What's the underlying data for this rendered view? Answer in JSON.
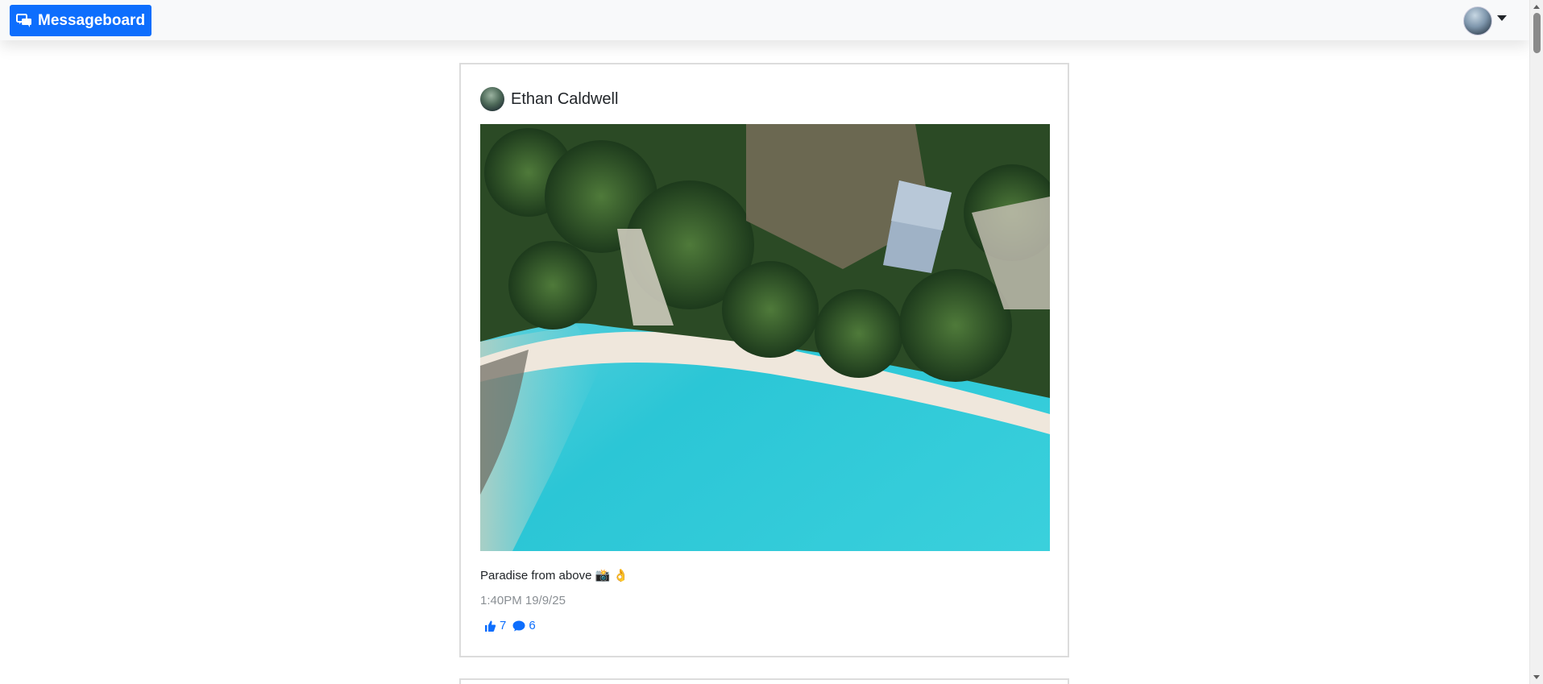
{
  "navbar": {
    "brand_label": "Messageboard",
    "brand_icon": "chat-bubbles-icon",
    "user_avatar": "user-avatar",
    "dropdown_icon": "caret-down-icon"
  },
  "post": {
    "author": "Ethan Caldwell",
    "image_alt": "aerial beach photo",
    "caption": "Paradise from above 📸 👌",
    "timestamp": "1:40PM 19/9/25",
    "likes": "7",
    "comments": "6",
    "like_icon": "thumbs-up-icon",
    "comment_icon": "comment-icon"
  },
  "colors": {
    "accent": "#0d6efd",
    "navbar_bg": "#f8f9fa",
    "card_border": "#dcdcdc",
    "muted_text": "#8a8f94"
  }
}
